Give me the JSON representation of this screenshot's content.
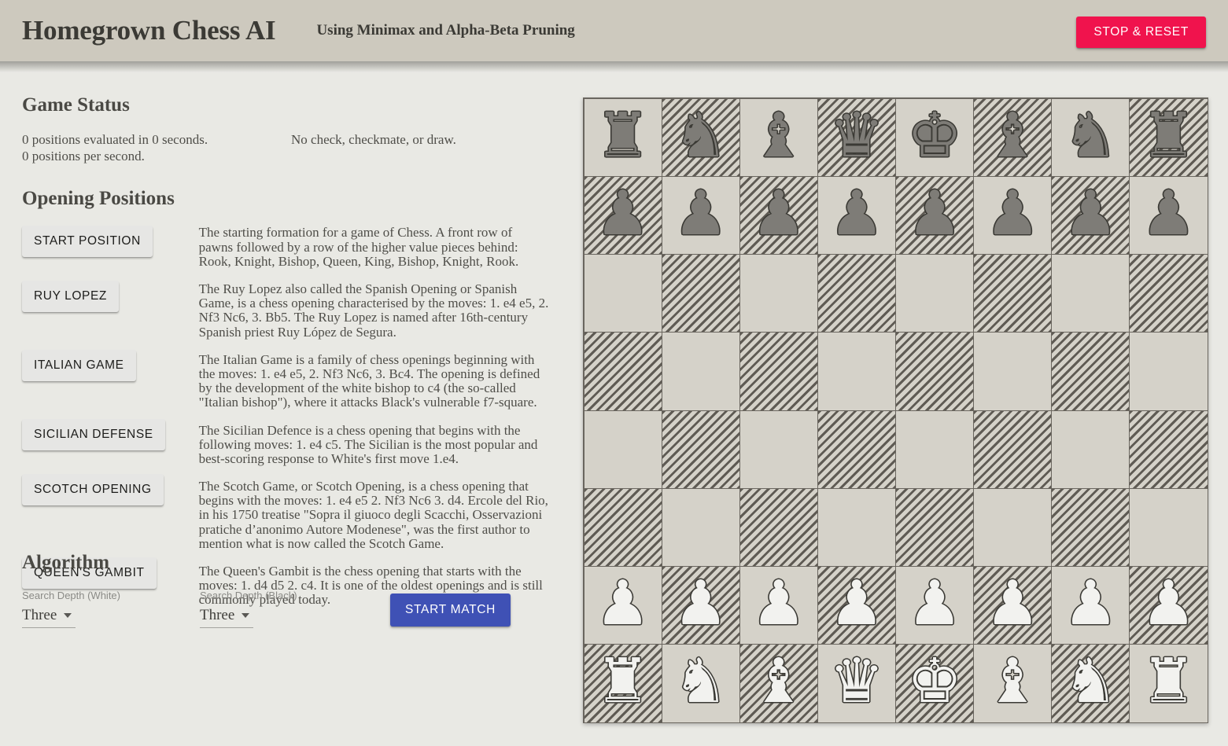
{
  "header": {
    "title": "Homegrown Chess AI",
    "subtitle": "Using Minimax and Alpha-Beta Pruning",
    "stop_reset_label": "STOP & RESET",
    "accent_pink": "#f0134d",
    "bar_color": "#cdc9be"
  },
  "game_status": {
    "heading": "Game Status",
    "positions_line": "0 positions evaluated in 0 seconds.",
    "rate_line": "0 positions per second.",
    "check_line": "No check, checkmate, or draw."
  },
  "openings": {
    "heading": "Opening Positions",
    "buttons": [
      {
        "label": "START POSITION"
      },
      {
        "label": "RUY LOPEZ"
      },
      {
        "label": "ITALIAN GAME"
      },
      {
        "label": "SICILIAN DEFENSE"
      },
      {
        "label": "SCOTCH OPENING"
      },
      {
        "label": "QUEEN'S GAMBIT"
      }
    ],
    "descriptions": [
      "The starting formation for a game of Chess. A front row of pawns followed by a row of the higher value pieces behind: Rook, Knight, Bishop, Queen, King, Bishop, Knight, Rook.",
      "The Ruy Lopez also called the Spanish Opening or Spanish Game, is a chess opening characterised by the moves: 1. e4 e5, 2. Nf3 Nc6, 3. Bb5. The Ruy Lopez is named after 16th-century Spanish priest Ruy López de Segura.",
      "The Italian Game is a family of chess openings beginning with the moves: 1. e4 e5, 2. Nf3 Nc6, 3. Bc4. The opening is defined by the development of the white bishop to c4 (the so-called \"Italian bishop\"), where it attacks Black's vulnerable f7-square.",
      "The Sicilian Defence is a chess opening that begins with the following moves: 1. e4 c5. The Sicilian is the most popular and best-scoring response to White's first move 1.e4.",
      "The Scotch Game, or Scotch Opening, is a chess opening that begins with the moves: 1. e4 e5 2. Nf3 Nc6 3. d4. Ercole del Rio, in his 1750 treatise \"Sopra il giuoco degli Scacchi, Osservazioni pratiche d’anonimo Autore Modenese\", was the first author to mention what is now called the Scotch Game.",
      "The Queen's Gambit is the chess opening that starts with the moves: 1. d4 d5 2. c4. It is one of the oldest openings and is still commonly played today."
    ]
  },
  "algorithm": {
    "heading": "Algorithm",
    "white_depth_label": "Search Depth (White)",
    "white_depth_value": "Three",
    "black_depth_label": "Search Depth (Black)",
    "black_depth_value": "Three",
    "start_match_label": "START MATCH",
    "start_match_color": "#3f51b5"
  },
  "board": {
    "light_square_color": "#d5d2c9",
    "dark_square_hatch_color": "#5f5b54",
    "border_color": "#6a665f",
    "rows": [
      [
        {
          "glyph": "♜",
          "color": "black",
          "name": "rook"
        },
        {
          "glyph": "♞",
          "color": "black",
          "name": "knight"
        },
        {
          "glyph": "♝",
          "color": "black",
          "name": "bishop"
        },
        {
          "glyph": "♛",
          "color": "black",
          "name": "queen"
        },
        {
          "glyph": "♚",
          "color": "black",
          "name": "king"
        },
        {
          "glyph": "♝",
          "color": "black",
          "name": "bishop"
        },
        {
          "glyph": "♞",
          "color": "black",
          "name": "knight"
        },
        {
          "glyph": "♜",
          "color": "black",
          "name": "rook"
        }
      ],
      [
        {
          "glyph": "♟",
          "color": "black",
          "name": "pawn"
        },
        {
          "glyph": "♟",
          "color": "black",
          "name": "pawn"
        },
        {
          "glyph": "♟",
          "color": "black",
          "name": "pawn"
        },
        {
          "glyph": "♟",
          "color": "black",
          "name": "pawn"
        },
        {
          "glyph": "♟",
          "color": "black",
          "name": "pawn"
        },
        {
          "glyph": "♟",
          "color": "black",
          "name": "pawn"
        },
        {
          "glyph": "♟",
          "color": "black",
          "name": "pawn"
        },
        {
          "glyph": "♟",
          "color": "black",
          "name": "pawn"
        }
      ],
      [
        null,
        null,
        null,
        null,
        null,
        null,
        null,
        null
      ],
      [
        null,
        null,
        null,
        null,
        null,
        null,
        null,
        null
      ],
      [
        null,
        null,
        null,
        null,
        null,
        null,
        null,
        null
      ],
      [
        null,
        null,
        null,
        null,
        null,
        null,
        null,
        null
      ],
      [
        {
          "glyph": "♟",
          "color": "white",
          "name": "pawn"
        },
        {
          "glyph": "♟",
          "color": "white",
          "name": "pawn"
        },
        {
          "glyph": "♟",
          "color": "white",
          "name": "pawn"
        },
        {
          "glyph": "♟",
          "color": "white",
          "name": "pawn"
        },
        {
          "glyph": "♟",
          "color": "white",
          "name": "pawn"
        },
        {
          "glyph": "♟",
          "color": "white",
          "name": "pawn"
        },
        {
          "glyph": "♟",
          "color": "white",
          "name": "pawn"
        },
        {
          "glyph": "♟",
          "color": "white",
          "name": "pawn"
        }
      ],
      [
        {
          "glyph": "♜",
          "color": "white",
          "name": "rook"
        },
        {
          "glyph": "♞",
          "color": "white",
          "name": "knight"
        },
        {
          "glyph": "♝",
          "color": "white",
          "name": "bishop"
        },
        {
          "glyph": "♛",
          "color": "white",
          "name": "queen"
        },
        {
          "glyph": "♚",
          "color": "white",
          "name": "king"
        },
        {
          "glyph": "♝",
          "color": "white",
          "name": "bishop"
        },
        {
          "glyph": "♞",
          "color": "white",
          "name": "knight"
        },
        {
          "glyph": "♜",
          "color": "white",
          "name": "rook"
        }
      ]
    ]
  }
}
